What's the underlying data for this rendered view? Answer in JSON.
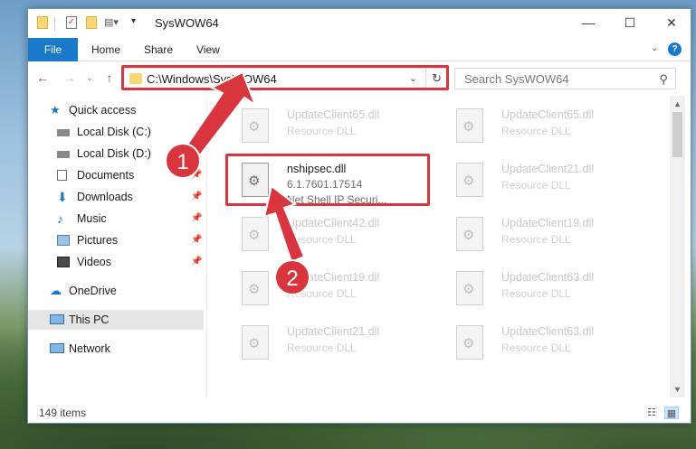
{
  "window": {
    "title": "SysWOW64"
  },
  "ribbon": {
    "file_tab": "File",
    "tabs": [
      "Home",
      "Share",
      "View"
    ]
  },
  "nav": {
    "address": "C:\\Windows\\SysWOW64",
    "search_placeholder": "Search SysWOW64"
  },
  "sidebar": {
    "items": [
      {
        "label": "Quick access",
        "icon": "star-icon",
        "pinned": false
      },
      {
        "label": "Local Disk (C:)",
        "icon": "drive-icon",
        "pinned": false
      },
      {
        "label": "Local Disk (D:)",
        "icon": "drive-icon",
        "pinned": false
      },
      {
        "label": "Documents",
        "icon": "document-icon",
        "pinned": true
      },
      {
        "label": "Downloads",
        "icon": "download-icon",
        "pinned": true
      },
      {
        "label": "Music",
        "icon": "music-icon",
        "pinned": true
      },
      {
        "label": "Pictures",
        "icon": "pictures-icon",
        "pinned": true
      },
      {
        "label": "Videos",
        "icon": "video-icon",
        "pinned": true
      },
      {
        "label": "OneDrive",
        "icon": "cloud-icon",
        "pinned": false
      },
      {
        "label": "This PC",
        "icon": "pc-icon",
        "pinned": false,
        "active": true
      },
      {
        "label": "Network",
        "icon": "network-icon",
        "pinned": false
      }
    ]
  },
  "files": {
    "left": [
      {
        "name": "UpdateClient65.dll",
        "sub": "Resource DLL"
      },
      {
        "name": "nshipsec.dll",
        "sub": "6.1.7601.17514",
        "sub2": "Net Shell IP Securi...",
        "highlighted": true
      },
      {
        "name": "UpdateClient42.dll",
        "sub": "Resource DLL"
      },
      {
        "name": "UpdateClient19.dll",
        "sub": "Resource DLL"
      },
      {
        "name": "UpdateClient21.dll",
        "sub": "Resource DLL"
      }
    ],
    "right": [
      {
        "name": "UpdateClient65.dll",
        "sub": "Resource DLL"
      },
      {
        "name": "UpdateClient21.dll",
        "sub": "Resource DLL"
      },
      {
        "name": "UpdateClient19.dll",
        "sub": "Resource DLL"
      },
      {
        "name": "UpdateClient63.dll",
        "sub": "Resource DLL"
      },
      {
        "name": "UpdateClient63.dll",
        "sub": "Resource DLL"
      }
    ]
  },
  "status": {
    "item_count": "149 items"
  },
  "callouts": {
    "one": "1",
    "two": "2"
  },
  "colors": {
    "accent": "#1979ca",
    "highlight_red": "#d9353f",
    "folder": "#f8d775"
  }
}
